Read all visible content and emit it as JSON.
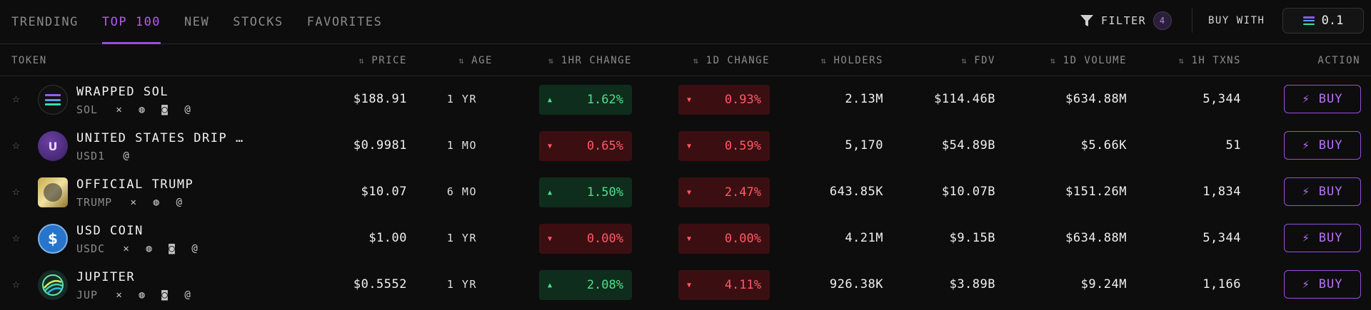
{
  "tabs": [
    "TRENDING",
    "TOP 100",
    "NEW",
    "STOCKS",
    "FAVORITES"
  ],
  "active_tab": "TOP 100",
  "filter": {
    "label": "FILTER",
    "count": "4"
  },
  "buy_with": {
    "label": "BUY WITH",
    "amount": "0.1"
  },
  "columns": {
    "token": "TOKEN",
    "price": "PRICE",
    "age": "AGE",
    "change_1h": "1HR CHANGE",
    "change_1d": "1D CHANGE",
    "holders": "HOLDERS",
    "fdv": "FDV",
    "volume_1d": "1D VOLUME",
    "txns_1h": "1H TXNS",
    "action": "ACTION"
  },
  "rows": [
    {
      "name": "WRAPPED SOL",
      "symbol": "SOL",
      "price": "$188.91",
      "age": "1 YR",
      "change_1h": "1.62%",
      "change_1h_dir": "up",
      "change_1d": "0.93%",
      "change_1d_dir": "down",
      "holders": "2.13M",
      "fdv": "$114.46B",
      "volume_1d": "$634.88M",
      "txns_1h": "5,344",
      "action": "BUY",
      "socials": [
        "x-icon",
        "globe-icon",
        "discord-icon",
        "at-icon"
      ],
      "logo": "sol-logo"
    },
    {
      "name": "UNITED STATES DRIP …",
      "symbol": "USD1",
      "price": "$0.9981",
      "age": "1 MO",
      "change_1h": "0.65%",
      "change_1h_dir": "down",
      "change_1d": "0.59%",
      "change_1d_dir": "down",
      "holders": "5,170",
      "fdv": "$54.89B",
      "volume_1d": "$5.66K",
      "txns_1h": "51",
      "action": "BUY",
      "socials": [
        "at-icon"
      ],
      "logo": "usd1-logo",
      "logo_letter": "U"
    },
    {
      "name": "OFFICIAL TRUMP",
      "symbol": "TRUMP",
      "price": "$10.07",
      "age": "6 MO",
      "change_1h": "1.50%",
      "change_1h_dir": "up",
      "change_1d": "2.47%",
      "change_1d_dir": "down",
      "holders": "643.85K",
      "fdv": "$10.07B",
      "volume_1d": "$151.26M",
      "txns_1h": "1,834",
      "action": "BUY",
      "socials": [
        "x-icon",
        "globe-icon",
        "at-icon"
      ],
      "logo": "trump-logo"
    },
    {
      "name": "USD COIN",
      "symbol": "USDC",
      "price": "$1.00",
      "age": "1 YR",
      "change_1h": "0.00%",
      "change_1h_dir": "down",
      "change_1d": "0.00%",
      "change_1d_dir": "down",
      "holders": "4.21M",
      "fdv": "$9.15B",
      "volume_1d": "$634.88M",
      "txns_1h": "5,344",
      "action": "BUY",
      "socials": [
        "x-icon",
        "globe-icon",
        "discord-icon",
        "at-icon"
      ],
      "logo": "usdc-logo"
    },
    {
      "name": "JUPITER",
      "symbol": "JUP",
      "price": "$0.5552",
      "age": "1 YR",
      "change_1h": "2.08%",
      "change_1h_dir": "up",
      "change_1d": "4.11%",
      "change_1d_dir": "down",
      "holders": "926.38K",
      "fdv": "$3.89B",
      "volume_1d": "$9.24M",
      "txns_1h": "1,166",
      "action": "BUY",
      "socials": [
        "x-icon",
        "globe-icon",
        "discord-icon",
        "at-icon"
      ],
      "logo": "jup-logo"
    }
  ],
  "colors": {
    "accent": "#9b4de0",
    "up": "#4ee08a",
    "up_bg": "#0f2d1c",
    "down": "#ff5965",
    "down_bg": "#3b0f12",
    "bg": "#0d0d0d"
  }
}
